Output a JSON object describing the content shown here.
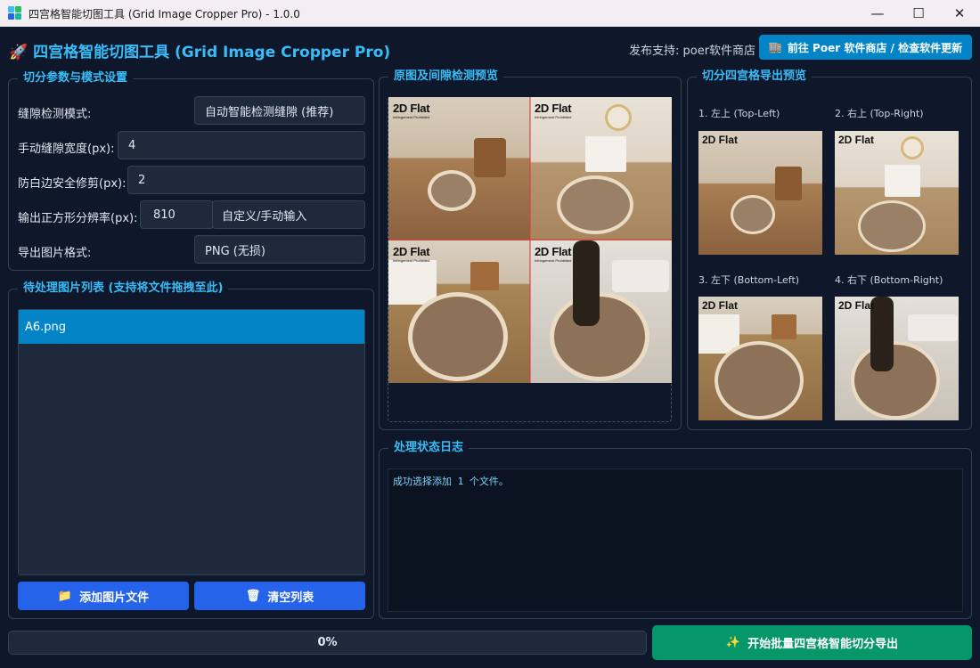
{
  "window": {
    "title": "四宫格智能切图工具 (Grid Image Cropper Pro) - 1.0.0",
    "minimize_glyph": "—",
    "maximize_glyph": "☐",
    "close_glyph": "✕"
  },
  "header": {
    "icon": "🚀",
    "title": "四宫格智能切图工具 (Grid Image Cropper Pro)",
    "publisher": "发布支持: poer软件商店",
    "store_button": "前往 Poer 软件商店 / 检查软件更新",
    "store_icon": "🏬"
  },
  "settings": {
    "group_title": "切分参数与模式设置",
    "gap_mode_label": "缝隙检测模式:",
    "gap_mode_value": "自动智能检测缝隙 (推荐)",
    "gap_width_label": "手动缝隙宽度(px):",
    "gap_width_value": "4",
    "trim_label": "防白边安全修剪(px):",
    "trim_value": "2",
    "resolution_label": "输出正方形分辨率(px):",
    "resolution_value": "810",
    "resolution_mode": "自定义/手动输入",
    "format_label": "导出图片格式:",
    "format_value": "PNG (无损)"
  },
  "file_list": {
    "group_title": "待处理图片列表 (支持将文件拖拽至此)",
    "items": [
      "A6.png"
    ],
    "add_button": "添加图片文件",
    "add_icon": "📁",
    "clear_button": "清空列表",
    "clear_icon": "🗑"
  },
  "preview": {
    "group_title": "原图及间隙检测预览",
    "watermark_brand": "2D Flat",
    "watermark_sub": "Infringement Prohibited"
  },
  "export_preview": {
    "group_title": "切分四宫格导出预览",
    "labels": [
      "1. 左上 (Top-Left)",
      "2. 右上 (Top-Right)",
      "3. 左下 (Bottom-Left)",
      "4. 右下 (Bottom-Right)"
    ],
    "watermark_brand": "2D Flat"
  },
  "log": {
    "group_title": "处理状态日志",
    "lines": [
      "成功选择添加 1 个文件。"
    ]
  },
  "progress": {
    "value": 0,
    "label": "0%"
  },
  "start_button": {
    "label": "开始批量四宫格智能切分导出",
    "icon": "✨"
  },
  "colors": {
    "background": "#0f172a",
    "accent": "#38bdf8",
    "panel": "#1e293b",
    "selection": "#0284c7",
    "primary_button": "#2563eb",
    "start_button": "#059669"
  }
}
